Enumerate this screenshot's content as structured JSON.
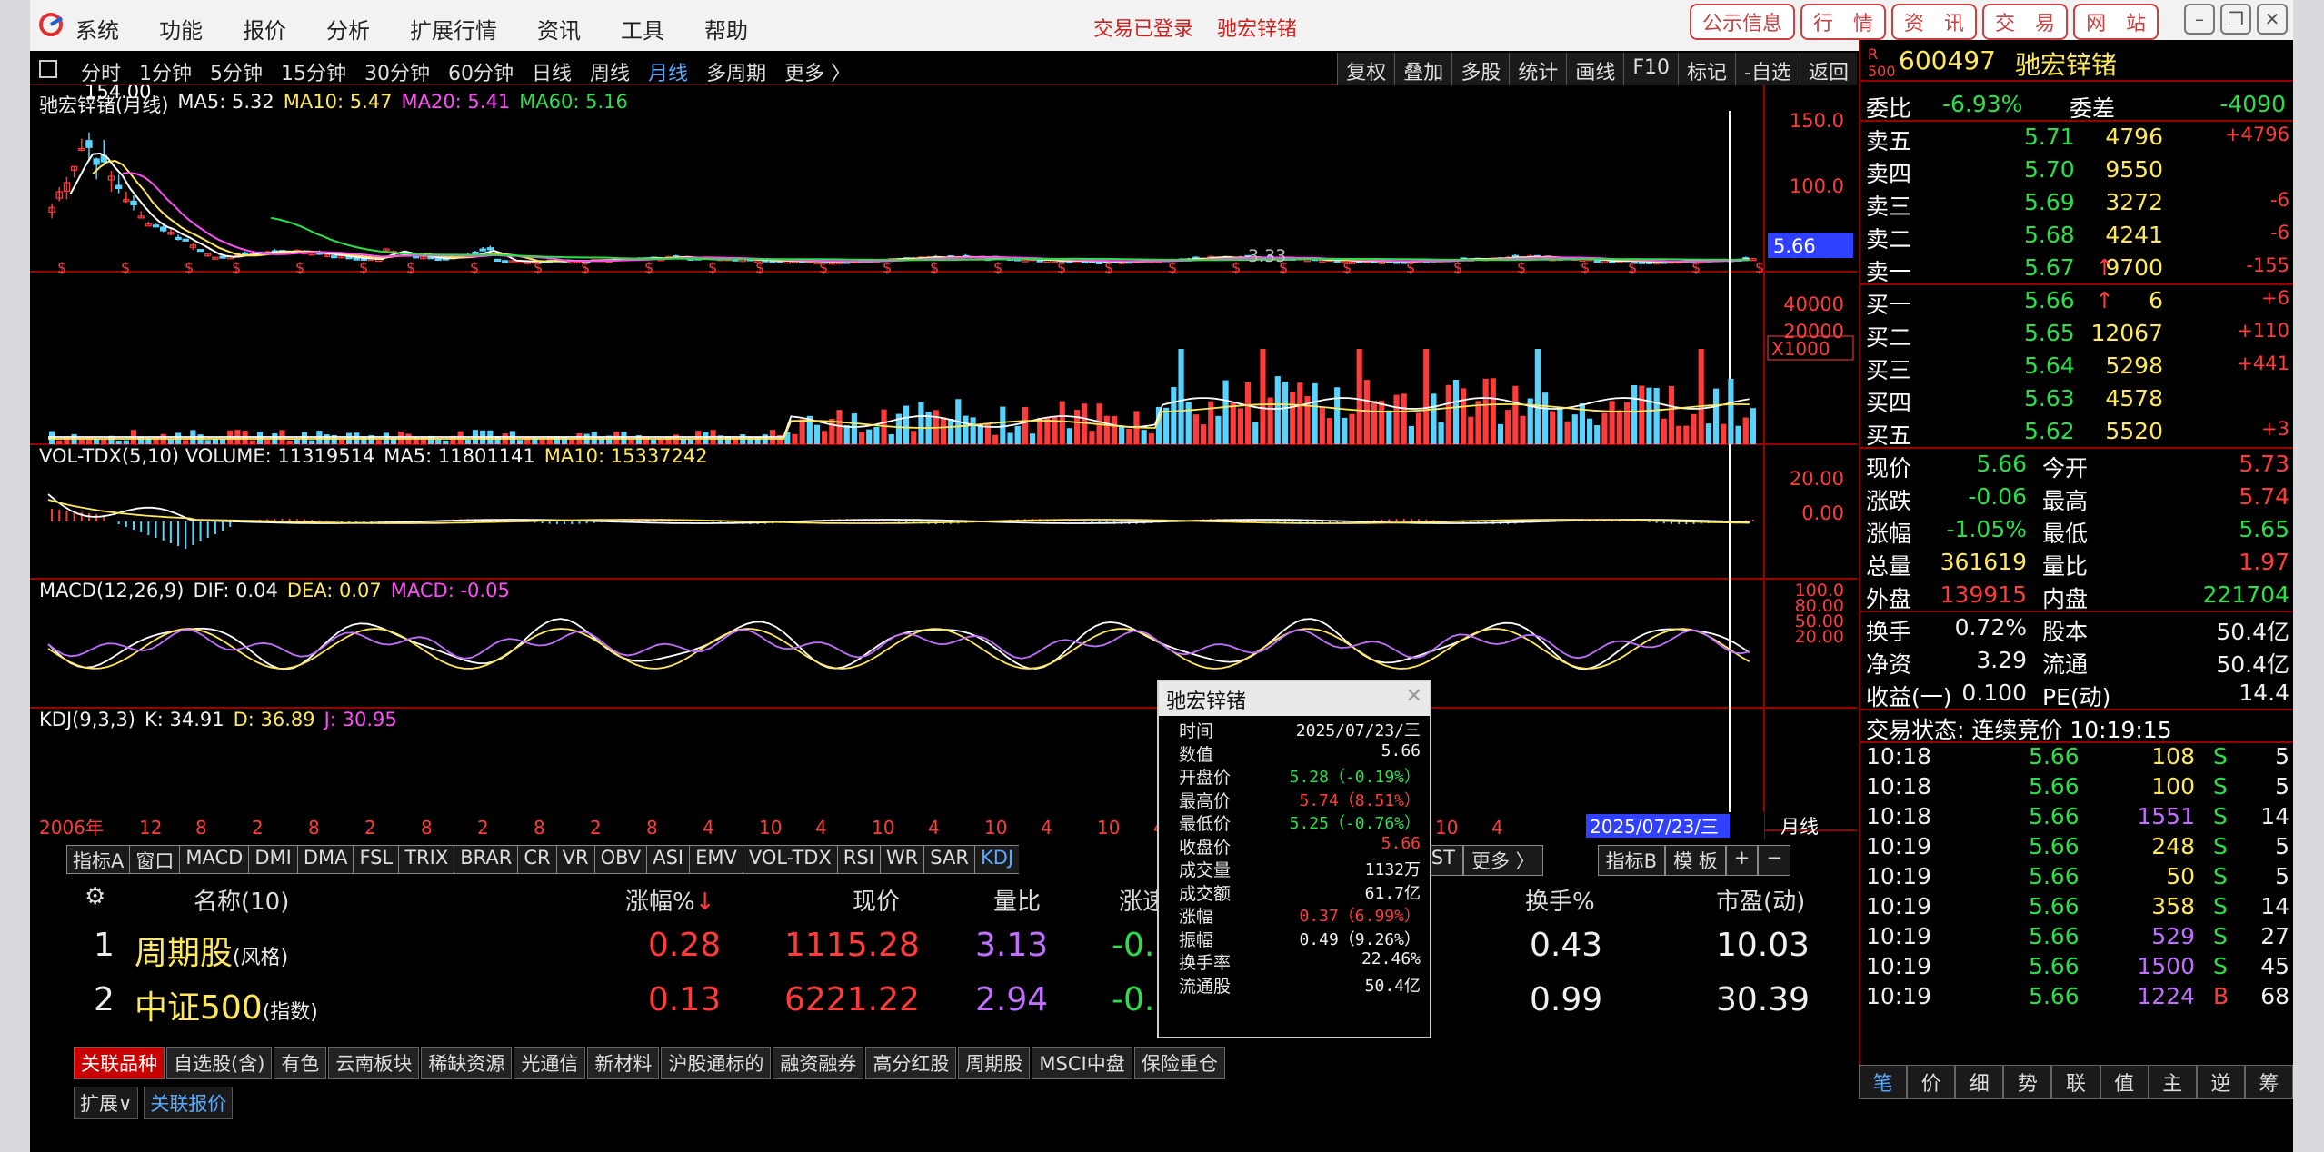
{
  "window": {
    "menu": [
      "系统",
      "功能",
      "报价",
      "分析",
      "扩展行情",
      "资讯",
      "工具",
      "帮助"
    ],
    "status_login": "交易已登录",
    "status_stock": "驰宏锌锗",
    "title_tabs": [
      "公示信息",
      "行　情",
      "资　讯",
      "交　易",
      "网　站"
    ]
  },
  "toolbar": {
    "periods": [
      "分时",
      "1分钟",
      "5分钟",
      "15分钟",
      "30分钟",
      "60分钟",
      "日线",
      "周线",
      "月线",
      "多周期",
      "更多 〉"
    ],
    "active_period": "月线",
    "right_tools": [
      "复权",
      "叠加",
      "多股",
      "统计",
      "画线",
      "F10",
      "标记",
      "-自选",
      "返回"
    ]
  },
  "main_chart": {
    "title": "驰宏锌锗(月线)",
    "ma5": "MA5: 5.32",
    "ma10": "MA10: 5.47",
    "ma20": "MA20: 5.41",
    "ma60": "MA60: 5.16",
    "peak_label": "154.00",
    "low_label": "3.33",
    "current_price_tag": "5.66",
    "axis_ticks": [
      "150.0",
      "100.0",
      "50.00"
    ]
  },
  "volume": {
    "header": "VOL-TDX(5,10) VOLUME: 11319514",
    "ma5": "MA5: 11801141",
    "ma10": "MA10: 15337242",
    "axis_ticks": [
      "40000",
      "20000"
    ],
    "unit": "X1000"
  },
  "macd": {
    "header": "MACD(12,26,9)",
    "dif": "DIF: 0.04",
    "dea": "DEA: 0.07",
    "macd": "MACD: -0.05",
    "axis_ticks": [
      "20.00",
      "0.00"
    ]
  },
  "kdj": {
    "header": "KDJ(9,3,3)",
    "k": "K: 34.91",
    "d": "D: 36.89",
    "j": "J: 30.95",
    "axis_ticks": [
      "100.0",
      "80.00",
      "50.00",
      "20.00"
    ]
  },
  "time_axis": {
    "start": "2006年",
    "labels": [
      "12",
      "8",
      "2",
      "8",
      "2",
      "8",
      "2",
      "8",
      "2",
      "8",
      "4",
      "10",
      "4",
      "10",
      "4",
      "10",
      "4",
      "10",
      "4",
      "10",
      "4",
      "10",
      "4",
      "10",
      "4"
    ],
    "cursor_date": "2025/07/23/三",
    "period_label": "月线"
  },
  "indicator_tabs": [
    "指标A",
    "窗口",
    "MACD",
    "DMI",
    "DMA",
    "FSL",
    "TRIX",
    "BRAR",
    "CR",
    "VR",
    "OBV",
    "ASI",
    "EMV",
    "VOL-TDX",
    "RSI",
    "WR",
    "SAR",
    "KDJ"
  ],
  "indicator_tabs_right": [
    "MCST",
    "更多 〉"
  ],
  "indicator_tabs_b": [
    "指标B",
    "模 板",
    "+",
    "−"
  ],
  "related": {
    "headers": {
      "name": "名称(10)",
      "change_pct": "涨幅%",
      "price": "现价",
      "vol_ratio": "量比",
      "speed": "涨速",
      "turnover": "换手%",
      "pe": "市盈(动)"
    },
    "rows": [
      {
        "idx": "1",
        "name": "周期股",
        "tag": "(风格)",
        "change_pct": "0.28",
        "price": "1115.28",
        "vol_ratio": "3.13",
        "speed": "-0.1",
        "turnover": "0.43",
        "pe": "10.03"
      },
      {
        "idx": "2",
        "name": "中证500",
        "tag": "(指数)",
        "change_pct": "0.13",
        "price": "6221.22",
        "vol_ratio": "2.94",
        "speed": "-0.1",
        "turnover": "0.99",
        "pe": "30.39"
      }
    ]
  },
  "sector_tabs": [
    "关联品种",
    "自选股(含)",
    "有色",
    "云南板块",
    "稀缺资源",
    "光通信",
    "新材料",
    "沪股通标的",
    "融资融券",
    "高分红股",
    "周期股",
    "MSCI中盘",
    "保险重仓"
  ],
  "bottom_bar": [
    "扩展∨",
    "关联报价"
  ],
  "quote": {
    "code": "600497",
    "name": "驰宏锌锗",
    "weibi_label": "委比",
    "weibi": "-6.93%",
    "weicha_label": "委差",
    "weicha": "-4090",
    "sells": [
      {
        "label": "卖五",
        "price": "5.71",
        "vol": "4796",
        "chg": "+4796",
        "arrow": ""
      },
      {
        "label": "卖四",
        "price": "5.70",
        "vol": "9550",
        "chg": "",
        "arrow": ""
      },
      {
        "label": "卖三",
        "price": "5.69",
        "vol": "3272",
        "chg": "-6",
        "arrow": ""
      },
      {
        "label": "卖二",
        "price": "5.68",
        "vol": "4241",
        "chg": "-6",
        "arrow": ""
      },
      {
        "label": "卖一",
        "price": "5.67",
        "vol": "9700",
        "chg": "-155",
        "arrow": "↑"
      }
    ],
    "buys": [
      {
        "label": "买一",
        "price": "5.66",
        "vol": "6",
        "chg": "+6",
        "arrow": "↑"
      },
      {
        "label": "买二",
        "price": "5.65",
        "vol": "12067",
        "chg": "+110",
        "arrow": ""
      },
      {
        "label": "买三",
        "price": "5.64",
        "vol": "5298",
        "chg": "+441",
        "arrow": ""
      },
      {
        "label": "买四",
        "price": "5.63",
        "vol": "4578",
        "chg": "",
        "arrow": ""
      },
      {
        "label": "买五",
        "price": "5.62",
        "vol": "5520",
        "chg": "+3",
        "arrow": ""
      }
    ],
    "stats": [
      {
        "l1": "现价",
        "v1": "5.66",
        "c1": "green",
        "l2": "今开",
        "v2": "5.73",
        "c2": "red"
      },
      {
        "l1": "涨跌",
        "v1": "-0.06",
        "c1": "green",
        "l2": "最高",
        "v2": "5.74",
        "c2": "red"
      },
      {
        "l1": "涨幅",
        "v1": "-1.05%",
        "c1": "green",
        "l2": "最低",
        "v2": "5.65",
        "c2": "green"
      },
      {
        "l1": "总量",
        "v1": "361619",
        "c1": "yellow",
        "l2": "量比",
        "v2": "1.97",
        "c2": "red"
      },
      {
        "l1": "外盘",
        "v1": "139915",
        "c1": "red",
        "l2": "内盘",
        "v2": "221704",
        "c2": "green"
      }
    ],
    "stats2": [
      {
        "l1": "换手",
        "v1": "0.72%",
        "l2": "股本",
        "v2": "50.4亿"
      },
      {
        "l1": "净资",
        "v1": "3.29",
        "l2": "流通",
        "v2": "50.4亿"
      },
      {
        "l1": "收益(一)",
        "v1": "0.100",
        "l2": "PE(动)",
        "v2": "14.4"
      }
    ],
    "trade_state": "交易状态: 连续竞价 10:19:15",
    "ticks": [
      {
        "t": "10:18",
        "p": "5.66",
        "v": "108",
        "vc": "yellow",
        "s": "S",
        "n": "5"
      },
      {
        "t": "10:18",
        "p": "5.66",
        "v": "100",
        "vc": "yellow",
        "s": "S",
        "n": "5"
      },
      {
        "t": "10:18",
        "p": "5.66",
        "v": "1551",
        "vc": "purple",
        "s": "S",
        "n": "14"
      },
      {
        "t": "10:19",
        "p": "5.66",
        "v": "248",
        "vc": "yellow",
        "s": "S",
        "n": "5"
      },
      {
        "t": "10:19",
        "p": "5.66",
        "v": "50",
        "vc": "yellow",
        "s": "S",
        "n": "5"
      },
      {
        "t": "10:19",
        "p": "5.66",
        "v": "358",
        "vc": "yellow",
        "s": "S",
        "n": "14"
      },
      {
        "t": "10:19",
        "p": "5.66",
        "v": "529",
        "vc": "purple",
        "s": "S",
        "n": "27"
      },
      {
        "t": "10:19",
        "p": "5.66",
        "v": "1500",
        "vc": "purple",
        "s": "S",
        "n": "45"
      },
      {
        "t": "10:19",
        "p": "5.66",
        "v": "1224",
        "vc": "purple",
        "s": "B",
        "n": "68"
      }
    ],
    "bottom_tabs": [
      "笔",
      "价",
      "细",
      "势",
      "联",
      "值",
      "主",
      "逆",
      "筹"
    ]
  },
  "popup": {
    "title": "驰宏锌锗",
    "rows": [
      {
        "label": "时间",
        "value": "2025/07/23/三",
        "color": "white"
      },
      {
        "label": "数值",
        "value": "5.66",
        "color": "white"
      },
      {
        "label": "开盘价",
        "value": "5.28（-0.19%）",
        "color": "green"
      },
      {
        "label": "最高价",
        "value": "5.74（8.51%）",
        "color": "red"
      },
      {
        "label": "最低价",
        "value": "5.25（-0.76%）",
        "color": "green"
      },
      {
        "label": "收盘价",
        "value": "5.66",
        "color": "red"
      },
      {
        "label": "成交量",
        "value": "1132万",
        "color": "white"
      },
      {
        "label": "成交额",
        "value": "61.7亿",
        "color": "white"
      },
      {
        "label": "涨幅",
        "value": "0.37（6.99%）",
        "color": "red"
      },
      {
        "label": "振幅",
        "value": "0.49（9.26%）",
        "color": "white"
      },
      {
        "label": "换手率",
        "value": "22.46%",
        "color": "white"
      },
      {
        "label": "流通股",
        "value": "50.4亿",
        "color": "white"
      }
    ]
  },
  "colors": {
    "up": "#ff3b3b",
    "down": "#29e04a",
    "bg": "#000000",
    "frame": "#990000",
    "accent_blue": "#5aa9ff"
  }
}
